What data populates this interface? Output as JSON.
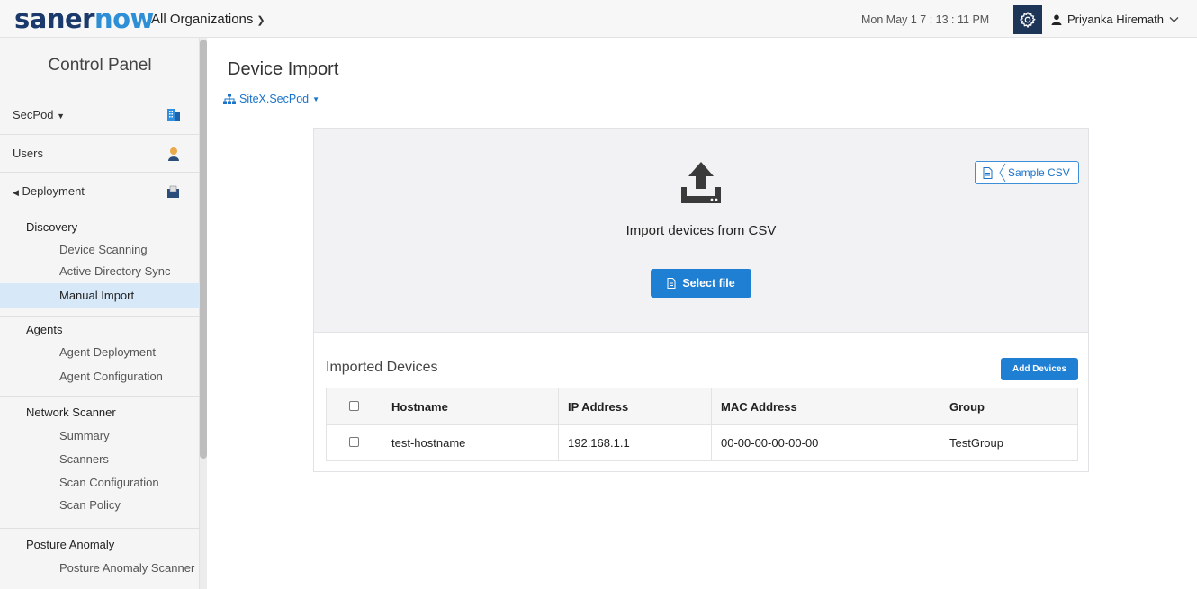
{
  "header": {
    "logo_part1": "saner",
    "logo_part2": "now",
    "org_selector": "All Organizations",
    "datetime": "Mon May 1  7 : 13 : 11 PM",
    "user_name": "Priyanka Hiremath",
    "accent_color": "#1f7fd2",
    "gear_bg_color": "#1d3557"
  },
  "sidebar": {
    "title": "Control Panel",
    "account": "SecPod",
    "users_label": "Users",
    "deployment_label": "Deployment",
    "sections": [
      {
        "heading": "Discovery",
        "items": [
          "Device Scanning",
          "Active Directory Sync",
          "Manual Import"
        ]
      },
      {
        "heading": "Agents",
        "items": [
          "Agent Deployment",
          "Agent Configuration"
        ]
      },
      {
        "heading": "Network Scanner",
        "items": [
          "Summary",
          "Scanners",
          "Scan Configuration",
          "Scan Policy"
        ]
      },
      {
        "heading": "Posture Anomaly",
        "items": [
          "Posture Anomaly Scanner"
        ]
      }
    ],
    "active_item": "Manual Import"
  },
  "main": {
    "title": "Device Import",
    "site_selector": "SiteX.SecPod",
    "import_text": "Import devices from CSV",
    "select_file_label": "Select file",
    "sample_csv_label": "Sample CSV",
    "imported_title": "Imported Devices",
    "add_devices_label": "Add Devices",
    "table": {
      "columns": [
        "Hostname",
        "IP Address",
        "MAC Address",
        "Group"
      ],
      "rows": [
        [
          "test-hostname",
          "192.168.1.1",
          "00-00-00-00-00-00",
          "TestGroup"
        ]
      ]
    }
  }
}
